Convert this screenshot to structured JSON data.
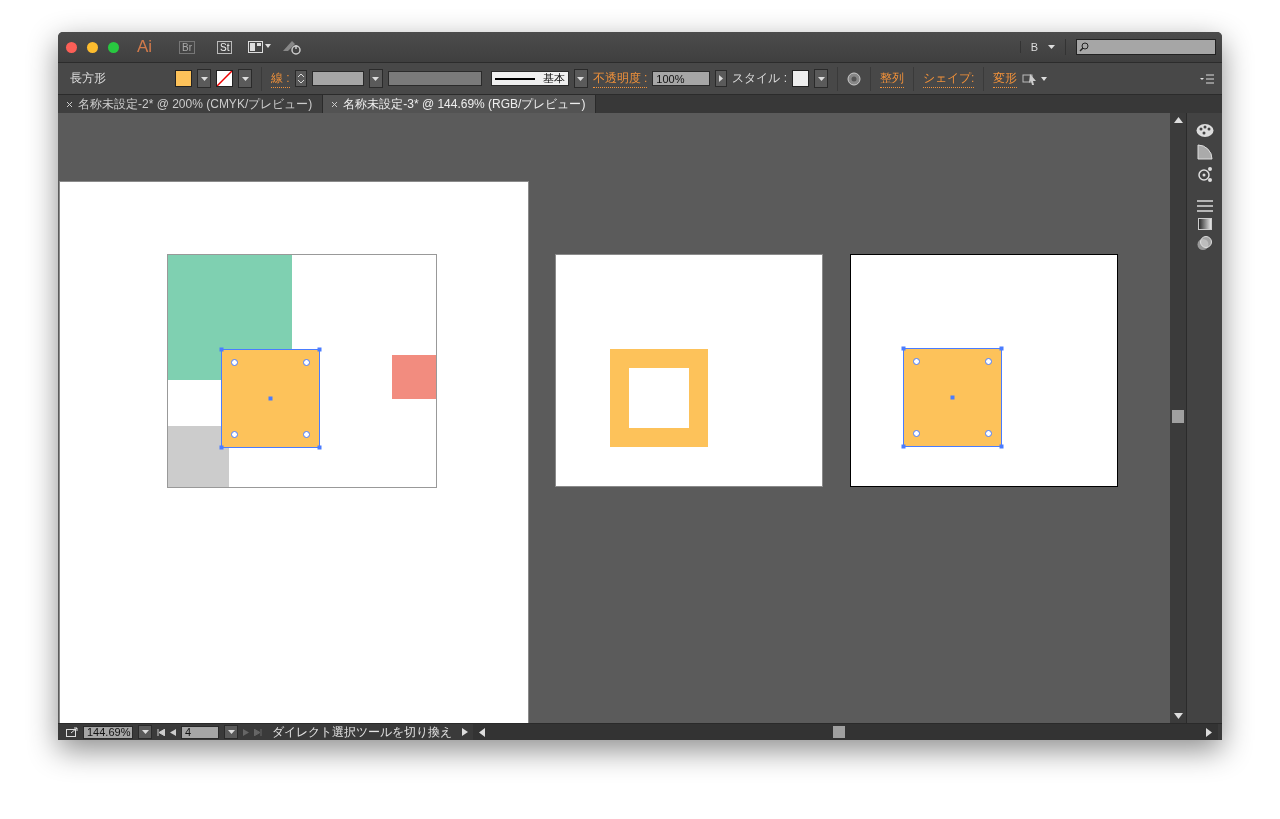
{
  "title_bar": {
    "logo": "Ai",
    "bridge": "Br",
    "stock": "St",
    "workspace": "B"
  },
  "control_bar": {
    "tool": "長方形",
    "stroke_label": "線 :",
    "stroke_profile": "基本",
    "opacity_label": "不透明度 :",
    "opacity": "100%",
    "style_label": "スタイル :",
    "align": "整列",
    "shape": "シェイプ:",
    "transform": "変形"
  },
  "tabs": [
    {
      "label": "名称未設定-2* @ 200% (CMYK/プレビュー)",
      "selected": false
    },
    {
      "label": "名称未設定-3* @ 144.69% (RGB/プレビュー)",
      "selected": true
    }
  ],
  "artboards": [
    {
      "kind": "composition",
      "selected": false,
      "square_selected": true
    },
    {
      "kind": "frame",
      "selected": false
    },
    {
      "kind": "square",
      "selected": true,
      "square_selected": true
    }
  ],
  "status_bar": {
    "zoom": "144.69%",
    "artboard": "4",
    "message": "ダイレクト選択ツールを切り換え"
  }
}
